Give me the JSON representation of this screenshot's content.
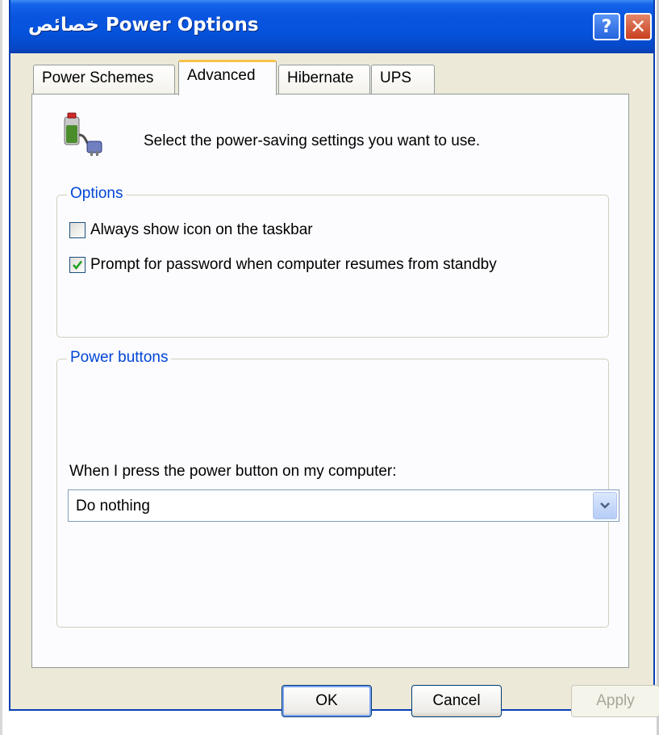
{
  "window": {
    "title": "خصائص Power Options",
    "help_glyph": "?",
    "close_glyph": "✕",
    "colors": {
      "titlebar": "#0553dc",
      "frame": "#ece9d8",
      "accent_tab": "#f6c34b",
      "group_legend": "#0046d5"
    }
  },
  "tabs": [
    {
      "label": "Power Schemes",
      "active": false
    },
    {
      "label": "Advanced",
      "active": true
    },
    {
      "label": "Hibernate",
      "active": false
    },
    {
      "label": "UPS",
      "active": false
    }
  ],
  "advanced": {
    "description": "Select the power-saving settings you want to use.",
    "icon": "power-plug-battery-icon",
    "options": {
      "legend": "Options",
      "checkboxes": [
        {
          "label": "Always show icon on the taskbar",
          "checked": false
        },
        {
          "label": "Prompt for password when computer resumes from standby",
          "checked": true
        }
      ]
    },
    "power_buttons": {
      "legend": "Power buttons",
      "prompt": "When I press the power button on my computer:",
      "selected": "Do nothing"
    }
  },
  "buttons": {
    "ok": "OK",
    "cancel": "Cancel",
    "apply": "Apply",
    "apply_enabled": false
  }
}
